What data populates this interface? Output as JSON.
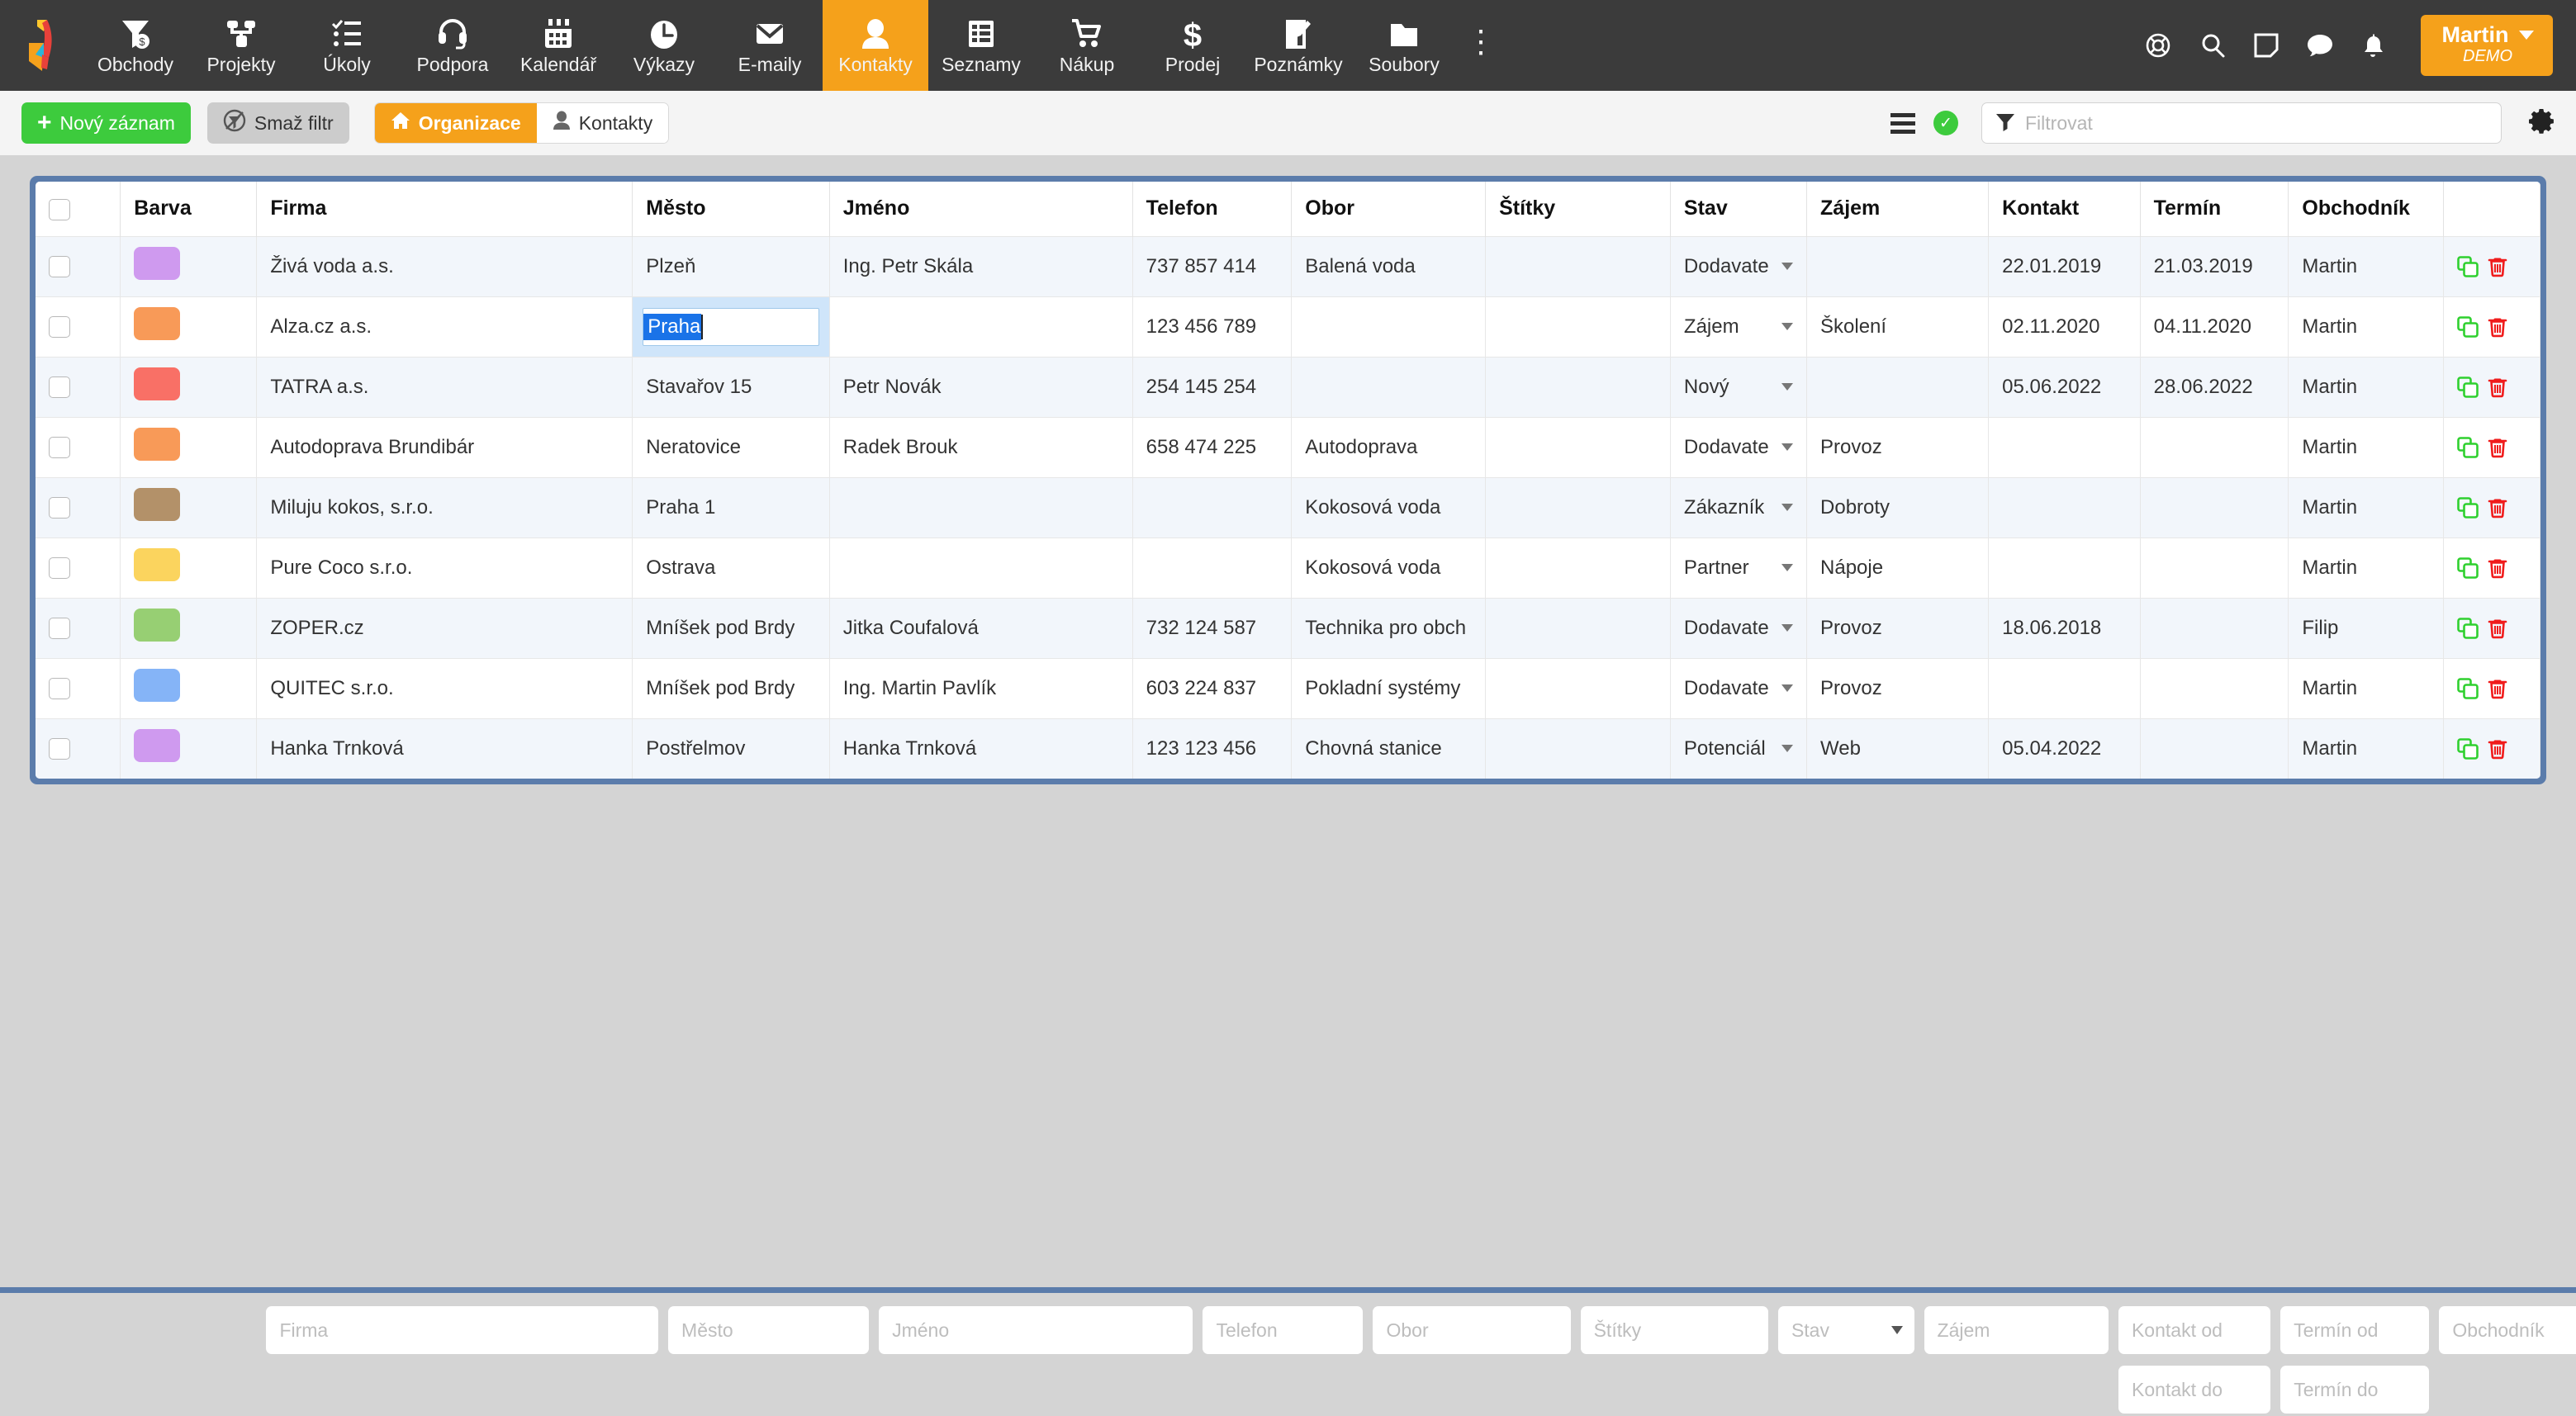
{
  "topnav": {
    "logo_icon": "giraffe-logo",
    "items": [
      {
        "label": "Obchody",
        "icon": "deal-funnel-icon",
        "active": false
      },
      {
        "label": "Projekty",
        "icon": "project-tree-icon",
        "active": false
      },
      {
        "label": "Úkoly",
        "icon": "checklist-icon",
        "active": false
      },
      {
        "label": "Podpora",
        "icon": "headset-icon",
        "active": false
      },
      {
        "label": "Kalendář",
        "icon": "calendar-icon",
        "active": false
      },
      {
        "label": "Výkazy",
        "icon": "clock-icon",
        "active": false
      },
      {
        "label": "E-maily",
        "icon": "envelope-icon",
        "active": false
      },
      {
        "label": "Kontakty",
        "icon": "person-icon",
        "active": true
      },
      {
        "label": "Seznamy",
        "icon": "list-table-icon",
        "active": false
      },
      {
        "label": "Nákup",
        "icon": "shopping-cart-icon",
        "active": false
      },
      {
        "label": "Prodej",
        "icon": "dollar-icon",
        "active": false
      },
      {
        "label": "Poznámky",
        "icon": "note-edit-icon",
        "active": false
      },
      {
        "label": "Soubory",
        "icon": "folder-icon",
        "active": false
      }
    ],
    "overflow_icon": "kebab-menu-icon",
    "right_icons": [
      "lifebuoy-icon",
      "search-icon",
      "sticky-note-icon",
      "chat-bubble-icon",
      "bell-icon"
    ],
    "user": {
      "name": "Martin",
      "subtitle": "DEMO",
      "caret_icon": "chevron-down-icon"
    },
    "accent": "#f5a11b",
    "background": "#3b3b3b"
  },
  "toolbar": {
    "new_record_label": "Nový záznam",
    "new_record_icon": "plus-icon",
    "clear_filter_label": "Smaž filtr",
    "clear_filter_icon": "filter-off-icon",
    "segment_org_label": "Organizace",
    "segment_org_icon": "home-icon",
    "segment_contacts_label": "Kontakty",
    "segment_contacts_icon": "person-icon",
    "list_view_icon": "list-lines-icon",
    "status_ok_icon": "check-circle-icon",
    "filter_icon": "funnel-icon",
    "filter_placeholder": "Filtrovat",
    "filter_value": "",
    "settings_icon": "gear-icon",
    "green": "#3dcb3d",
    "grey": "#cccccc"
  },
  "table": {
    "headers": [
      "",
      "Barva",
      "Firma",
      "Město",
      "Jméno",
      "Telefon",
      "Obor",
      "Štítky",
      "Stav",
      "Zájem",
      "Kontakt",
      "Termín",
      "Obchodník",
      ""
    ],
    "copy_icon": "copy-icon",
    "delete_icon": "trash-icon",
    "copy_color": "#2fd02f",
    "delete_color": "#f01c1c",
    "rows": [
      {
        "color": "#cf9aef",
        "firma": "Živá voda a.s.",
        "mesto": "Plzeň",
        "jmeno": "Ing. Petr Skála",
        "telefon": "737 857 414",
        "obor": "Balená voda",
        "stitky": "",
        "stav": "Dodavate",
        "zajem": "",
        "kontakt": "22.01.2019",
        "termin": "21.03.2019",
        "termin_overdue": true,
        "obchodnik": "Martin",
        "editing": false
      },
      {
        "color": "#f89a58",
        "firma": "Alza.cz a.s.",
        "mesto": "Praha",
        "jmeno": "",
        "telefon": "123 456 789",
        "obor": "",
        "stitky": "",
        "stav": "Zájem",
        "zajem": "Školení",
        "kontakt": "02.11.2020",
        "termin": "04.11.2020",
        "termin_overdue": true,
        "obchodnik": "Martin",
        "editing": true
      },
      {
        "color": "#f97066",
        "firma": "TATRA a.s.",
        "mesto": "Stavařov 15",
        "jmeno": "Petr Novák",
        "telefon": "254 145 254",
        "obor": "",
        "stitky": "",
        "stav": "Nový",
        "zajem": "",
        "kontakt": "05.06.2022",
        "termin": "28.06.2022",
        "termin_overdue": false,
        "obchodnik": "Martin",
        "editing": false
      },
      {
        "color": "#f89a58",
        "firma": "Autodoprava Brundibár",
        "mesto": "Neratovice",
        "jmeno": "Radek Brouk",
        "telefon": "658 474 225",
        "obor": "Autodoprava",
        "stitky": "",
        "stav": "Dodavate",
        "zajem": "Provoz",
        "kontakt": "",
        "termin": "",
        "termin_overdue": false,
        "obchodnik": "Martin",
        "editing": false
      },
      {
        "color": "#b39169",
        "firma": "Miluju kokos, s.r.o.",
        "mesto": "Praha 1",
        "jmeno": "",
        "telefon": "",
        "obor": "Kokosová voda",
        "stitky": "",
        "stav": "Zákazník",
        "zajem": "Dobroty",
        "kontakt": "",
        "termin": "",
        "termin_overdue": false,
        "obchodnik": "Martin",
        "editing": false
      },
      {
        "color": "#fbd45e",
        "firma": "Pure Coco s.r.o.",
        "mesto": "Ostrava",
        "jmeno": "",
        "telefon": "",
        "obor": "Kokosová voda",
        "stitky": "",
        "stav": "Partner",
        "zajem": "Nápoje",
        "kontakt": "",
        "termin": "",
        "termin_overdue": false,
        "obchodnik": "Martin",
        "editing": false
      },
      {
        "color": "#97cf73",
        "firma": "ZOPER.cz",
        "mesto": "Mníšek pod Brdy",
        "jmeno": "Jitka Coufalová",
        "telefon": "732 124 587",
        "obor": "Technika pro obch",
        "stitky": "",
        "stav": "Dodavate",
        "zajem": "Provoz",
        "kontakt": "18.06.2018",
        "termin": "",
        "termin_overdue": false,
        "obchodnik": "Filip",
        "editing": false
      },
      {
        "color": "#85b4f7",
        "firma": "QUITEC s.r.o.",
        "mesto": "Mníšek pod Brdy",
        "jmeno": "Ing. Martin Pavlík",
        "telefon": "603 224 837",
        "obor": "Pokladní systémy",
        "stitky": "",
        "stav": "Dodavate",
        "zajem": "Provoz",
        "kontakt": "",
        "termin": "",
        "termin_overdue": false,
        "obchodnik": "Martin",
        "editing": false
      },
      {
        "color": "#cf9aef",
        "firma": "Hanka Trnková",
        "mesto": "Postřelmov",
        "jmeno": "Hanka Trnková",
        "telefon": "123 123 456",
        "obor": "Chovná stanice",
        "stitky": "",
        "stav": "Potenciál",
        "zajem": "Web",
        "kontakt": "05.04.2022",
        "termin": "",
        "termin_overdue": false,
        "obchodnik": "Martin",
        "editing": false
      }
    ],
    "edit_cell": {
      "value": "Praha",
      "selected": true
    }
  },
  "bottom_filters": {
    "row1": [
      {
        "name": "firma",
        "placeholder": "Firma",
        "value": "",
        "type": "text"
      },
      {
        "name": "mesto",
        "placeholder": "Město",
        "value": "",
        "type": "text"
      },
      {
        "name": "jmeno",
        "placeholder": "Jméno",
        "value": "",
        "type": "text"
      },
      {
        "name": "telefon",
        "placeholder": "Telefon",
        "value": "",
        "type": "text"
      },
      {
        "name": "obor",
        "placeholder": "Obor",
        "value": "",
        "type": "text"
      },
      {
        "name": "stitky",
        "placeholder": "Štítky",
        "value": "",
        "type": "text"
      },
      {
        "name": "stav",
        "placeholder": "Stav",
        "value": "",
        "type": "select"
      },
      {
        "name": "zajem",
        "placeholder": "Zájem",
        "value": "",
        "type": "text"
      },
      {
        "name": "kontakt_od",
        "placeholder": "Kontakt od",
        "value": "",
        "type": "text"
      },
      {
        "name": "termin_od",
        "placeholder": "Termín od",
        "value": "",
        "type": "text"
      },
      {
        "name": "obchodnik",
        "placeholder": "Obchodník",
        "value": "",
        "type": "text"
      }
    ],
    "row2": [
      {
        "name": "kontakt_do",
        "placeholder": "Kontakt do",
        "value": "",
        "type": "text"
      },
      {
        "name": "termin_do",
        "placeholder": "Termín do",
        "value": "",
        "type": "text"
      }
    ]
  }
}
